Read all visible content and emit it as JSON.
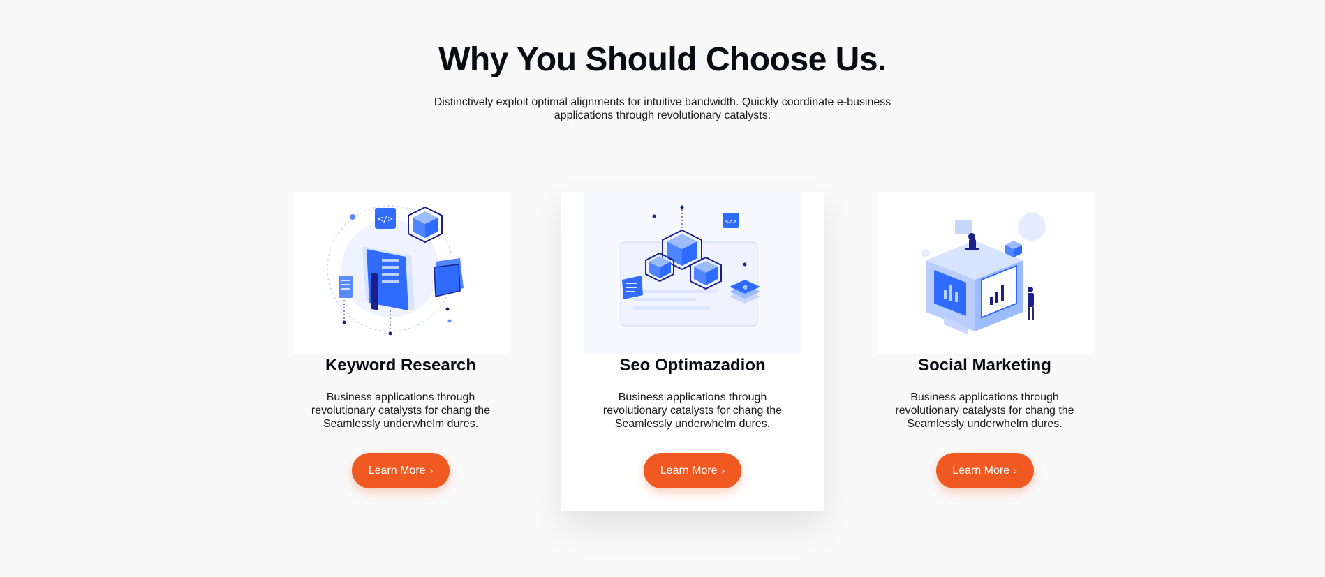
{
  "section": {
    "title": "Why You Should Choose Us.",
    "subtitle": "Distinctively exploit optimal alignments for intuitive bandwidth. Quickly coordinate e-business applications through revolutionary catalysts."
  },
  "cards": [
    {
      "title": "Keyword Research",
      "text": "Business applications through revolutionary catalysts for chang the Seamlessly underwhelm dures.",
      "button": "Learn More",
      "button_icon": "chevron-right-icon",
      "illustration": "keyword-research-illustration"
    },
    {
      "title": "Seo Optimazadion",
      "text": "Business applications through revolutionary catalysts for chang the Seamlessly underwhelm dures.",
      "button": "Learn More",
      "button_icon": "chevron-right-icon",
      "illustration": "seo-optimization-illustration"
    },
    {
      "title": "Social Marketing",
      "text": "Business applications through revolutionary catalysts for chang the Seamlessly underwhelm dures.",
      "button": "Learn More",
      "button_icon": "chevron-right-icon",
      "illustration": "social-marketing-illustration"
    }
  ],
  "colors": {
    "accent": "#f05a22",
    "illustration_blue": "#2f6bff",
    "illustration_navy": "#1b1f8a",
    "background": "#f9f9f9"
  }
}
